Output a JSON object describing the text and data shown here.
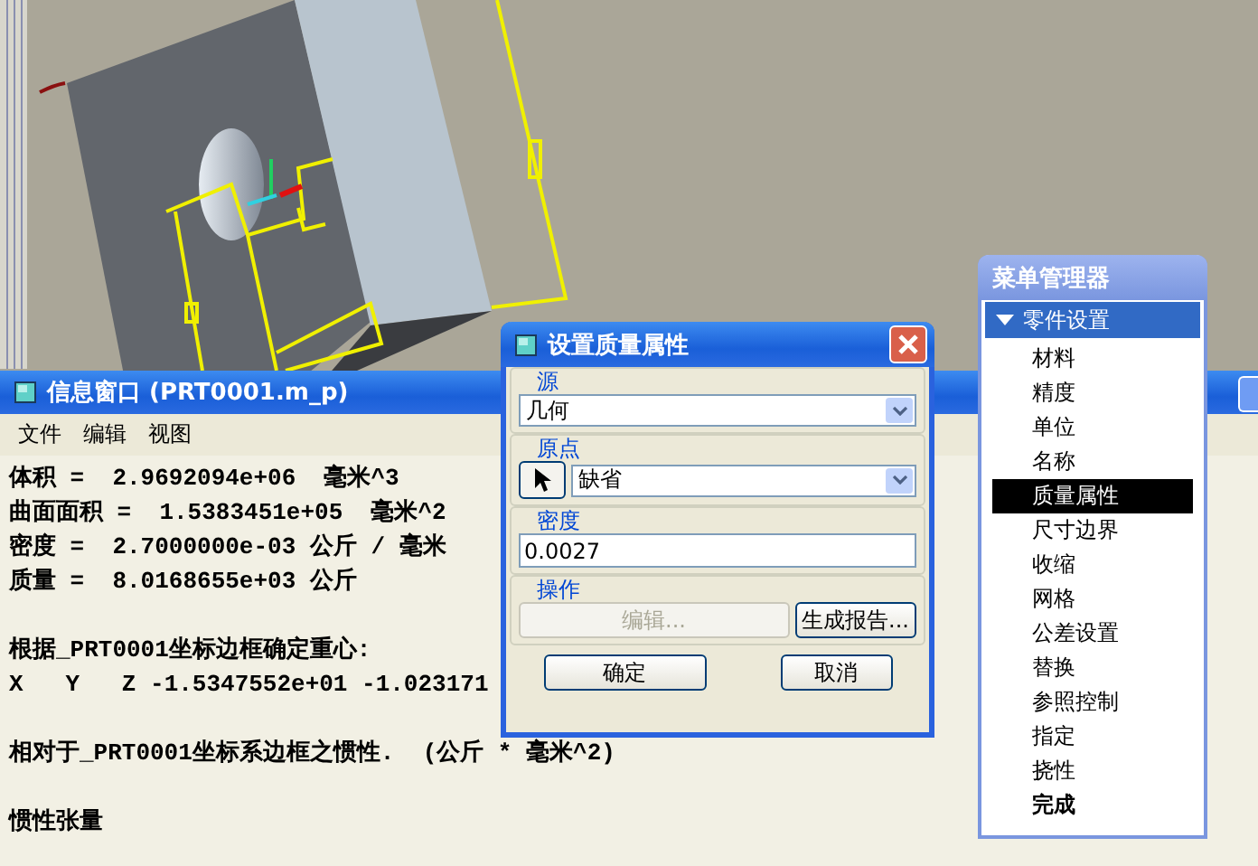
{
  "info_window": {
    "title": "信息窗口 (PRT0001.m_p)",
    "menu": [
      "文件",
      "编辑",
      "视图"
    ],
    "paragraphs": [
      [
        "体积 =  2.9692094e+06  毫米^3",
        "曲面面积 =  1.5383451e+05  毫米^2",
        "密度 =  2.7000000e-03 公斤 / 毫米",
        "质量 =  8.0168655e+03 公斤"
      ],
      [
        "根据_PRT0001坐标边框确定重心:",
        "X   Y   Z -1.5347552e+01 -1.023171"
      ],
      [
        "相对于_PRT0001坐标系边框之惯性.  (公斤 * 毫米^2)"
      ],
      [
        "惯性张量"
      ]
    ]
  },
  "dialog": {
    "title": "设置质量属性",
    "groups": [
      {
        "label": "源",
        "kind": "select",
        "value": "几何"
      },
      {
        "label": "原点",
        "kind": "pick-select",
        "value": "缺省"
      },
      {
        "label": "密度",
        "kind": "input",
        "value": "0.0027"
      },
      {
        "label": "操作",
        "kind": "buttons",
        "buttons": [
          {
            "label": "编辑...",
            "disabled": true
          },
          {
            "label": "生成报告...",
            "disabled": false
          }
        ]
      }
    ],
    "buttons": [
      "确定",
      "取消"
    ]
  },
  "menu_manager": {
    "title": "菜单管理器",
    "section": {
      "label": "零件设置",
      "expanded": true
    },
    "items": [
      {
        "label": "材料",
        "selected": false,
        "bold": false
      },
      {
        "label": "精度",
        "selected": false,
        "bold": false
      },
      {
        "label": "单位",
        "selected": false,
        "bold": false
      },
      {
        "label": "名称",
        "selected": false,
        "bold": false
      },
      {
        "label": "质量属性",
        "selected": true,
        "bold": false
      },
      {
        "label": "尺寸边界",
        "selected": false,
        "bold": false
      },
      {
        "label": "收缩",
        "selected": false,
        "bold": false
      },
      {
        "label": "网格",
        "selected": false,
        "bold": false
      },
      {
        "label": "公差设置",
        "selected": false,
        "bold": false
      },
      {
        "label": "替换",
        "selected": false,
        "bold": false
      },
      {
        "label": "参照控制",
        "selected": false,
        "bold": false
      },
      {
        "label": "指定",
        "selected": false,
        "bold": false
      },
      {
        "label": "挠性",
        "selected": false,
        "bold": false
      },
      {
        "label": "完成",
        "selected": false,
        "bold": true
      }
    ]
  }
}
